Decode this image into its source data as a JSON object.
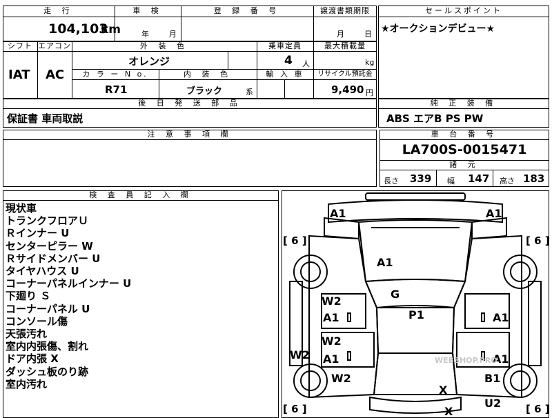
{
  "header_row": {
    "mileage_label": "走 行",
    "inspection_label": "車 検",
    "registration_label": "登 録 番 号",
    "transfer_label": "譲渡書類期限",
    "sales_point_label": "セールスポイント"
  },
  "mileage": {
    "value": "104,103",
    "unit": "km"
  },
  "inspection": {
    "year_unit": "年",
    "month_unit": "月"
  },
  "transfer": {
    "month_unit": "月",
    "day_unit": "日"
  },
  "sales_point": {
    "text": "★オークションデビュー★"
  },
  "labels": {
    "shift": "シフト",
    "aircon": "エアコン",
    "exterior_color": "外 装 色",
    "capacity": "乗車定員",
    "max_load": "最大積載量",
    "color_no": "カ ラ ー N o.",
    "interior_color": "内 装 色",
    "import": "輸 入 車",
    "recycle": "リサイクル預託金",
    "later_parts": "後 日 発 送 部 品",
    "standard_equipment": "純 正 装 備",
    "notes": "注 意 事 項 欄",
    "chassis_no": "車 台 番 号",
    "specs": "諸 元",
    "inspector_notes": "検 査 員 記 入 欄"
  },
  "vehicle": {
    "shift": "IAT",
    "aircon": "AC",
    "exterior_color": "オレンジ",
    "capacity": "4",
    "capacity_unit": "人",
    "max_load_unit": "kg",
    "color_no": "R71",
    "interior_color": "ブラック",
    "interior_suffix": "系",
    "recycle_fee": "9,490",
    "recycle_unit": "円",
    "later_parts": "保証書 車両取説",
    "standard_equipment": "ABS エアB PS PW",
    "chassis_no": "LA700S-0015471"
  },
  "specs": {
    "length_label": "長さ",
    "length": "339",
    "width_label": "幅",
    "width": "147",
    "height_label": "高さ",
    "height": "183"
  },
  "inspector_notes": [
    "現状車",
    "トランクフロアＵ",
    "Ｒインナー U",
    "センターピラー W",
    "Ｒサイドメンバー U",
    "タイヤハウス U",
    "コーナーパネルインナー U",
    "下廻り Ｓ",
    "コーナーパネル U",
    "コンソール傷",
    "天張汚れ",
    "室内内張傷、割れ",
    "ドア内張 X",
    "ダッシュ板のり跡",
    "室内汚れ"
  ],
  "diagram_marks": {
    "front_left": "A1",
    "front_right": "A1",
    "tire_fl": "6",
    "tire_fr": "6",
    "tire_rl": "6",
    "tire_rr": "6",
    "hood": "A1",
    "windshield": "G",
    "roof": "P1",
    "left_front_door_top": "W2",
    "left_front_door": "A1",
    "left_rear_door_top": "W2",
    "left_rear_door": "A1",
    "left_sill": "W2",
    "left_rear_fender": "W2",
    "right_front_door": "A1",
    "right_rear_door": "A1",
    "right_rear_fender": "B1",
    "right_rear_corner": "U2",
    "rear_glass": "X",
    "rear_bottom": "X"
  },
  "watermark": "WEBSHOP.PRO"
}
